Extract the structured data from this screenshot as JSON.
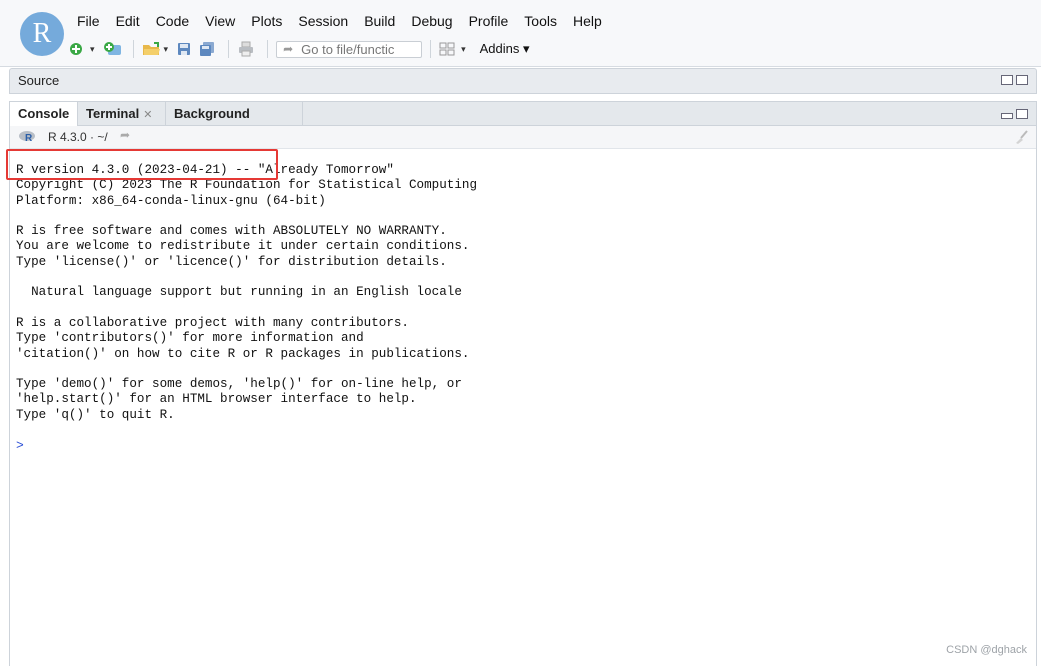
{
  "app": {
    "logo_letter": "R",
    "accent": "#75aadb",
    "highlight_color": "#e53935"
  },
  "menubar": {
    "items": [
      {
        "label": "File"
      },
      {
        "label": "Edit"
      },
      {
        "label": "Code"
      },
      {
        "label": "View"
      },
      {
        "label": "Plots"
      },
      {
        "label": "Session"
      },
      {
        "label": "Build"
      },
      {
        "label": "Debug"
      },
      {
        "label": "Profile"
      },
      {
        "label": "Tools"
      },
      {
        "label": "Help"
      }
    ]
  },
  "toolbar": {
    "goto_placeholder": "Go to file/functic",
    "addins_label": "Addins",
    "icons": [
      "new-file-icon",
      "new-project-icon",
      "open-file-icon",
      "save-icon",
      "save-all-icon",
      "print-icon",
      "grid-layout-icon"
    ]
  },
  "source_pane": {
    "title": "Source"
  },
  "console_pane": {
    "tabs": [
      {
        "label": "Console",
        "closable": false,
        "active": true
      },
      {
        "label": "Terminal",
        "closable": true,
        "active": false
      },
      {
        "label": "Background Jobs",
        "closable": true,
        "active": false
      }
    ],
    "path": "R 4.3.0 · ~/",
    "output_lines": [
      "R version 4.3.0 (2023-04-21) -- \"Already Tomorrow\"",
      "Copyright (C) 2023 The R Foundation for Statistical Computing",
      "Platform: x86_64-conda-linux-gnu (64-bit)",
      "",
      "R is free software and comes with ABSOLUTELY NO WARRANTY.",
      "You are welcome to redistribute it under certain conditions.",
      "Type 'license()' or 'licence()' for distribution details.",
      "",
      "  Natural language support but running in an English locale",
      "",
      "R is a collaborative project with many contributors.",
      "Type 'contributors()' for more information and",
      "'citation()' on how to cite R or R packages in publications.",
      "",
      "Type 'demo()' for some demos, 'help()' for on-line help, or",
      "'help.start()' for an HTML browser interface to help.",
      "Type 'q()' to quit R."
    ],
    "prompt": ">"
  },
  "watermark": "CSDN @dghack"
}
